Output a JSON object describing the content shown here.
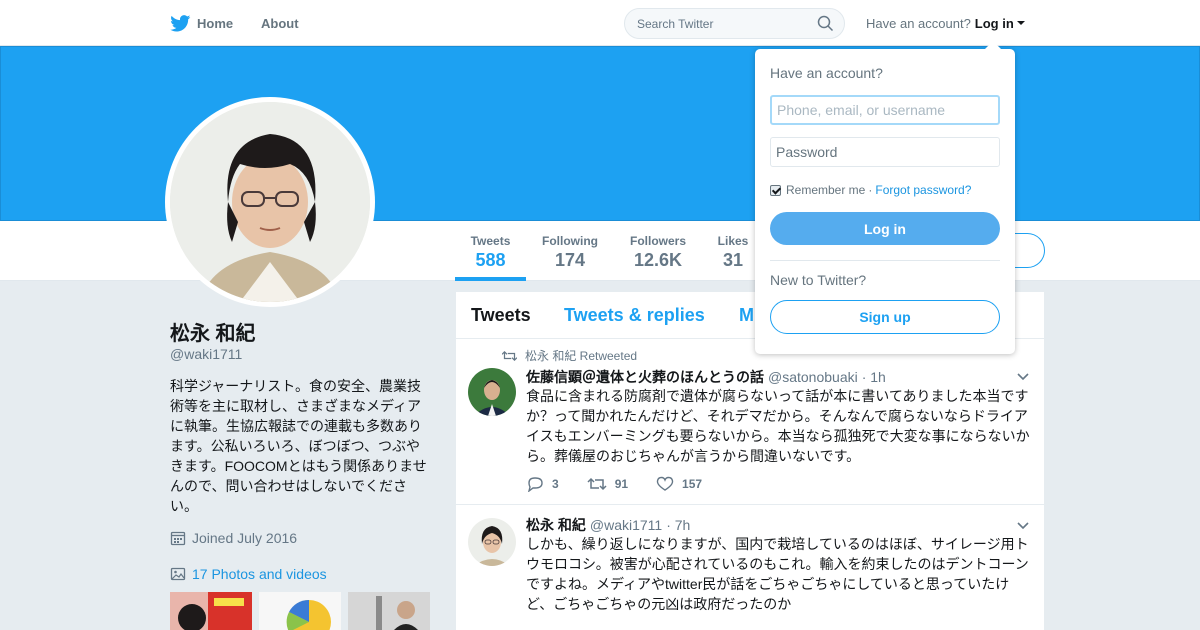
{
  "nav": {
    "home_label": "Home",
    "about_label": "About",
    "search_placeholder": "Search Twitter",
    "have_account": "Have an account?",
    "login_label": "Log in"
  },
  "profile": {
    "name": "松永 和紀",
    "handle": "@waki1711",
    "bio": "科学ジャーナリスト。食の安全、農業技術等を主に取材し、さまざまなメディアに執筆。生協広報誌での連載も多数あります。公私いろいろ、ぼつぼつ、つぶやきます。FOOCOMとはもう関係ありませんので、問い合わせはしないでください。",
    "joined": "Joined July 2016",
    "photos": "17 Photos and videos"
  },
  "stats": [
    {
      "label": "Tweets",
      "value": "588",
      "active": true
    },
    {
      "label": "Following",
      "value": "174",
      "active": false
    },
    {
      "label": "Followers",
      "value": "12.6K",
      "active": false
    },
    {
      "label": "Likes",
      "value": "31",
      "active": false
    }
  ],
  "timeline": {
    "tabs": [
      "Tweets",
      "Tweets & replies",
      "M"
    ],
    "tweets": [
      {
        "retweet_context": "松永 和紀 Retweeted",
        "name": "佐藤信顕＠遺体と火葬のほんとうの話",
        "handle": "@satonobuaki",
        "time": "· 1h",
        "text": "食品に含まれる防腐剤で遺体が腐らないって話が本に書いてありました本当ですか？って聞かれたんだけど、それデマだから。そんなんで腐らないならドライアイスもエンバーミングも要らないから。本当なら孤独死で大変な事にならないから。葬儀屋のおじちゃんが言うから間違いないです。",
        "replies": "3",
        "retweets": "91",
        "likes": "157"
      },
      {
        "name": "松永 和紀",
        "handle": "@waki1711",
        "time": "· 7h",
        "text": "しかも、繰り返しになりますが、国内で栽培しているのはほぼ、サイレージ用トウモロコシ。被害が心配されているのもこれ。輸入を約束したのはデントコーンですよね。メディアやtwitter民が話をごちゃごちゃにしていると思っていたけど、ごちゃごちゃの元凶は政府だったのか"
      }
    ]
  },
  "login": {
    "title": "Have an account?",
    "username_placeholder": "Phone, email, or username",
    "password_placeholder": "Password",
    "remember": "Remember me",
    "separator": "·",
    "forgot": "Forgot password?",
    "login_button": "Log in",
    "new_to_twitter": "New to Twitter?",
    "signup_button": "Sign up"
  },
  "colors": {
    "brand": "#1da1f2",
    "link": "#1b95e0",
    "login_button": "#55acee"
  }
}
